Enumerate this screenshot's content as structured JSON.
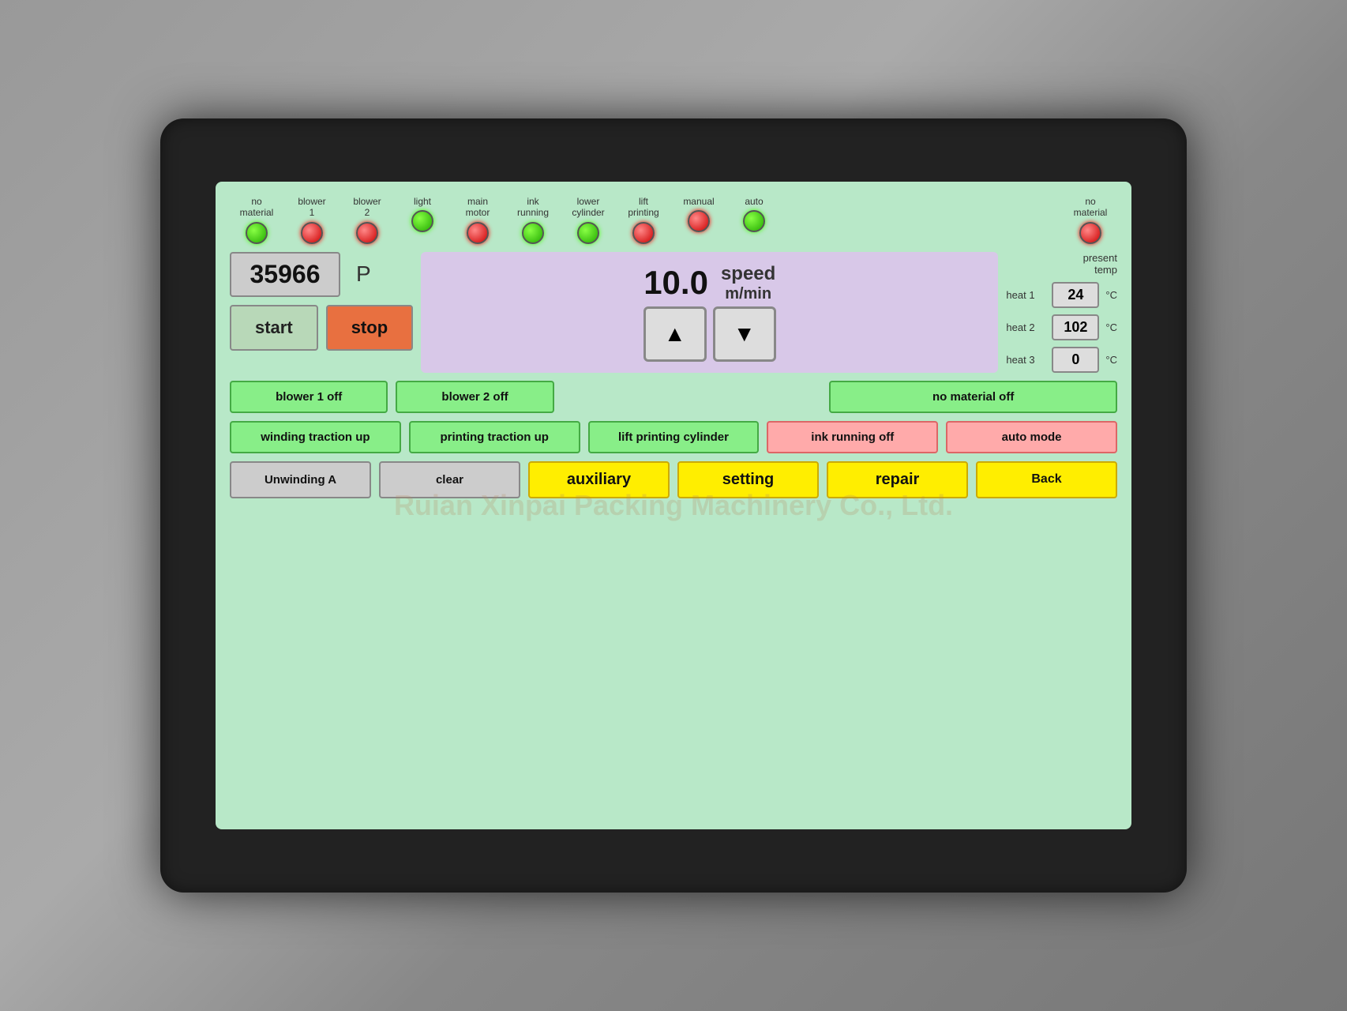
{
  "machine": {
    "watermark": "Ruian Xinpai Packing Machinery Co., Ltd."
  },
  "status_indicators": [
    {
      "id": "no-material",
      "label": "no\nmaterial",
      "led": "green"
    },
    {
      "id": "blower1",
      "label": "blower\n1",
      "led": "red"
    },
    {
      "id": "blower2",
      "label": "blower\n2",
      "led": "red"
    },
    {
      "id": "light",
      "label": "light",
      "led": "green"
    },
    {
      "id": "main-motor",
      "label": "main\nmotor",
      "led": "red"
    },
    {
      "id": "ink-running",
      "label": "ink\nrunning",
      "led": "green"
    },
    {
      "id": "lower-cylinder",
      "label": "lower\ncylinder",
      "led": "green"
    },
    {
      "id": "lift-printing",
      "label": "lift\nprinting",
      "led": "red"
    },
    {
      "id": "manual",
      "label": "manual",
      "led": "red"
    },
    {
      "id": "auto",
      "label": "auto",
      "led": "green"
    },
    {
      "id": "no-material2",
      "label": "no\nmaterial",
      "led": "red"
    }
  ],
  "counter": {
    "value": "35966",
    "p_label": "P"
  },
  "speed": {
    "value": "10.0",
    "unit": "m/min",
    "label": "speed"
  },
  "heat": {
    "present_temp_label": "present\ntemp",
    "items": [
      {
        "id": "heat1",
        "label": "heat 1",
        "value": "24",
        "unit": "°C"
      },
      {
        "id": "heat2",
        "label": "heat 2",
        "value": "102",
        "unit": "°C"
      },
      {
        "id": "heat3",
        "label": "heat 3",
        "value": "0",
        "unit": "°C"
      }
    ]
  },
  "buttons": {
    "start": "start",
    "stop": "stop",
    "blower1_off": "blower 1\noff",
    "blower2_off": "blower 2\noff",
    "no_material_off": "no material\noff",
    "winding_traction_up": "winding traction\nup",
    "printing_traction_up": "printing traction\nup",
    "lift_printing_cylinder": "lift printing\ncylinder",
    "ink_running_off": "ink running\noff",
    "auto_mode": "auto mode",
    "unwinding_a": "Unwinding A",
    "clear": "clear",
    "auxiliary": "auxiliary",
    "setting": "setting",
    "repair": "repair",
    "back": "Back"
  }
}
